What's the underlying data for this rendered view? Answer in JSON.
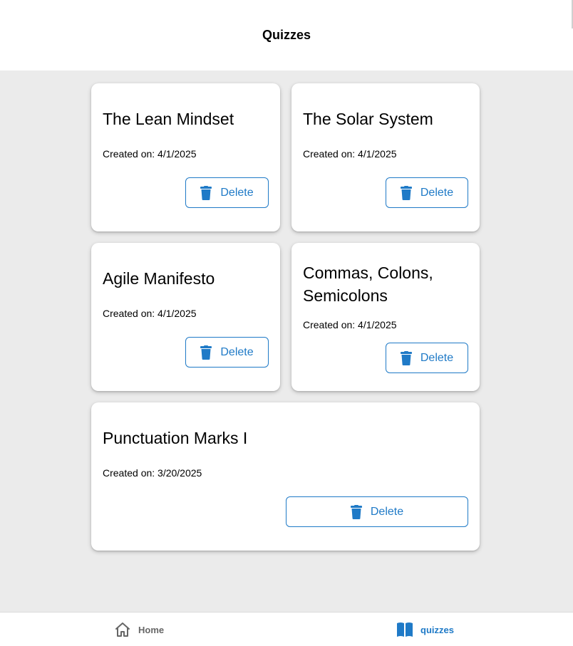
{
  "header": {
    "title": "Quizzes"
  },
  "cards": [
    {
      "title": "The Lean Mindset",
      "date": "Created on: 4/1/2025",
      "delete_label": "Delete"
    },
    {
      "title": "The Solar System",
      "date": "Created on: 4/1/2025",
      "delete_label": "Delete"
    },
    {
      "title": "Agile Manifesto",
      "date": "Created on: 4/1/2025",
      "delete_label": "Delete"
    },
    {
      "title": "Commas, Colons, Semicolons",
      "date": "Created on: 4/1/2025",
      "delete_label": "Delete"
    },
    {
      "title": "Punctuation Marks I",
      "date": "Created on: 3/20/2025",
      "delete_label": "Delete"
    }
  ],
  "tabbar": {
    "home_label": "Home",
    "quizzes_label": "quizzes",
    "active_tab": "quizzes"
  },
  "colors": {
    "accent": "#1f7ac7",
    "background": "#ebebeb",
    "inactive_tab": "#666666"
  },
  "icons": {
    "delete": "trash-icon",
    "home": "home-icon",
    "quizzes": "book-open-icon"
  }
}
